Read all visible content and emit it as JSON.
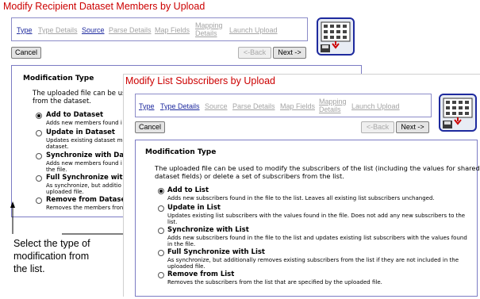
{
  "back_window": {
    "title": "Modify Recipient Dataset Members by Upload",
    "tabs": [
      "Type",
      "Type Details",
      "Source",
      "Parse Details",
      "Map Fields",
      "Mapping Details",
      "Launch Upload"
    ],
    "mapping_line1": "Mapping",
    "mapping_line2": "Details",
    "cancel_label": "Cancel",
    "back_label": "<-Back",
    "next_label": "Next ->",
    "section_title": "Modification Type",
    "intro_line1": "The uploaded file can be used",
    "intro_line2": "from the dataset.",
    "options": [
      {
        "label": "Add to Dataset",
        "desc": [
          "Adds new members found i"
        ]
      },
      {
        "label": "Update in Dataset",
        "desc": [
          "Updates existing dataset me",
          "dataset."
        ]
      },
      {
        "label": "Synchronize with Dataset",
        "desc": [
          "Adds new members found i",
          "the file."
        ]
      },
      {
        "label": "Full Synchronize with Da",
        "desc": [
          "As synchronize, but additio",
          "uploaded file."
        ]
      },
      {
        "label": "Remove from Dataset",
        "desc": [
          "Removes the members fron"
        ]
      }
    ]
  },
  "front_window": {
    "title": "Modify List Subscribers by Upload",
    "tabs": [
      "Type",
      "Type Details",
      "Source",
      "Parse Details",
      "Map Fields",
      "Mapping Details",
      "Launch Upload"
    ],
    "mapping_line1": "Mapping",
    "mapping_line2": "Details",
    "cancel_label": "Cancel",
    "back_label": "<-Back",
    "next_label": "Next ->",
    "section_title": "Modification Type",
    "intro_line1": "The uploaded file can be used to modify the subscribers of the list (including the values for shared",
    "intro_line2": "dataset fields) or delete a set of subscribers from the list.",
    "options": [
      {
        "label": "Add to List",
        "desc": [
          "Adds new subscribers found in the file to the list. Leaves all existing list subscribers unchanged."
        ]
      },
      {
        "label": "Update in List",
        "desc": [
          "Updates existing list subscribers with the values found in the file. Does not add any new subscribers to the",
          "list."
        ]
      },
      {
        "label": "Synchronize with List",
        "desc": [
          "Adds new subscribers found in the file to the list and updates existing list subscribers with the values found",
          "in the file."
        ]
      },
      {
        "label": "Full Synchronize with List",
        "desc": [
          "As synchronize, but additionally removes existing subscribers from the list if they are not included in the",
          "uploaded file."
        ]
      },
      {
        "label": "Remove from List",
        "desc": [
          "Removes the subscribers from the list that are specified by the uploaded file."
        ]
      }
    ]
  },
  "callout": {
    "lines": [
      "Select the type of",
      "modification from",
      "the list."
    ]
  },
  "colors": {
    "title_red": "#cc0000",
    "link_blue": "#1e2a9e",
    "panel_border": "#7c7cc4"
  },
  "icons": [
    "wizard-icon"
  ]
}
